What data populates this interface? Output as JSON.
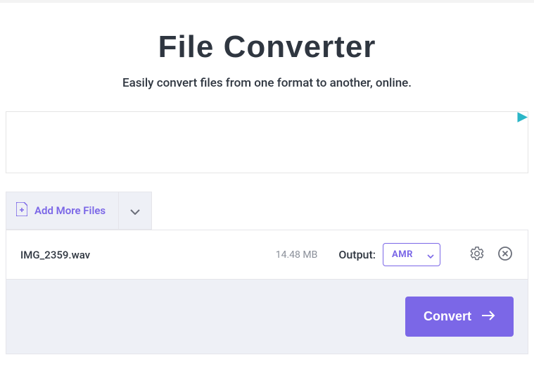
{
  "header": {
    "title": "File Converter",
    "subtitle": "Easily convert files from one format to another, online."
  },
  "add": {
    "label": "Add More Files"
  },
  "file": {
    "name": "IMG_2359.wav",
    "size": "14.48 MB",
    "output_label": "Output:",
    "output_value": "AMR"
  },
  "actions": {
    "convert": "Convert"
  }
}
